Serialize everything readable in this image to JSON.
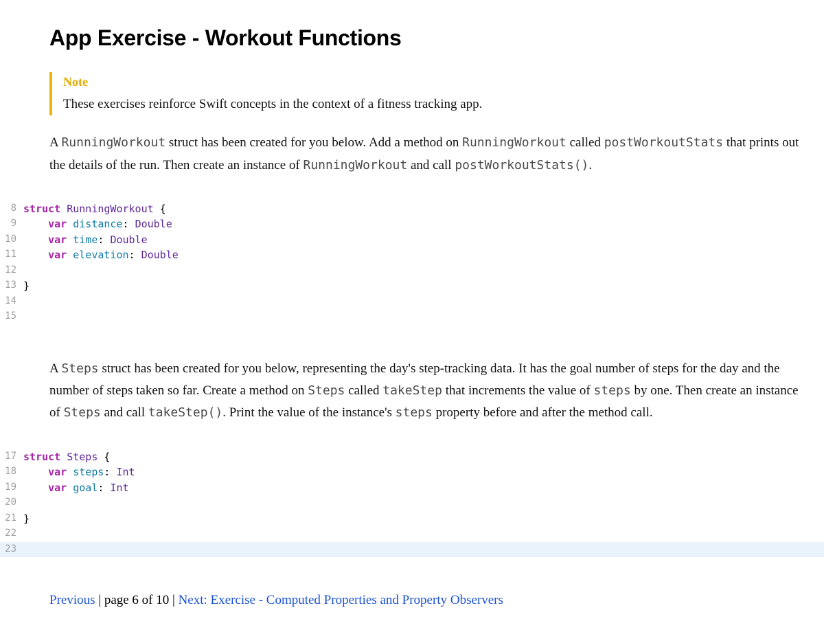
{
  "title": "App Exercise - Workout Functions",
  "note": {
    "label": "Note",
    "body": "These exercises reinforce Swift concepts in the context of a fitness tracking app."
  },
  "para1": {
    "t0": "A ",
    "c0": "RunningWorkout",
    "t1": " struct has been created for you below. Add a method on ",
    "c1": "RunningWorkout",
    "t2": " called ",
    "c2": "postWorkoutStats",
    "t3": " that prints out the details of the run. Then create an instance of ",
    "c3": "RunningWorkout",
    "t4": " and call ",
    "c4": "postWorkoutStats()",
    "t5": "."
  },
  "code1": {
    "start": 8,
    "lines": [
      [
        {
          "kw": "struct"
        },
        " ",
        {
          "type": "RunningWorkout"
        },
        " {"
      ],
      [
        "    ",
        {
          "kw": "var"
        },
        " ",
        {
          "id": "distance"
        },
        ": ",
        {
          "type": "Double"
        }
      ],
      [
        "    ",
        {
          "kw": "var"
        },
        " ",
        {
          "id": "time"
        },
        ": ",
        {
          "type": "Double"
        }
      ],
      [
        "    ",
        {
          "kw": "var"
        },
        " ",
        {
          "id": "elevation"
        },
        ": ",
        {
          "type": "Double"
        }
      ],
      [
        ""
      ],
      [
        "}"
      ],
      [
        ""
      ],
      [
        ""
      ]
    ],
    "highlight": -1
  },
  "para2": {
    "t0": "A ",
    "c0": "Steps",
    "t1": " struct has been created for you below, representing the day's step-tracking data. It has the goal number of steps for the day and the number of steps taken so far. Create a method on ",
    "c1": "Steps",
    "t2": " called ",
    "c2": "takeStep",
    "t3": " that increments the value of ",
    "c3": "steps",
    "t4": " by one. Then create an instance of ",
    "c4": "Steps",
    "t5": " and call ",
    "c5": "takeStep()",
    "t6": ". Print the value of the instance's ",
    "c6": "steps",
    "t7": " property before and after the method call."
  },
  "code2": {
    "start": 17,
    "lines": [
      [
        {
          "kw": "struct"
        },
        " ",
        {
          "type": "Steps"
        },
        " {"
      ],
      [
        "    ",
        {
          "kw": "var"
        },
        " ",
        {
          "id": "steps"
        },
        ": ",
        {
          "type": "Int"
        }
      ],
      [
        "    ",
        {
          "kw": "var"
        },
        " ",
        {
          "id": "goal"
        },
        ": ",
        {
          "type": "Int"
        }
      ],
      [
        ""
      ],
      [
        "}"
      ],
      [
        ""
      ],
      [
        ""
      ]
    ],
    "highlight": 6
  },
  "pager": {
    "prev": "Previous",
    "sep": "  |  ",
    "page": "page 6 of 10",
    "next": "Next: Exercise - Computed Properties and Property Observers"
  }
}
